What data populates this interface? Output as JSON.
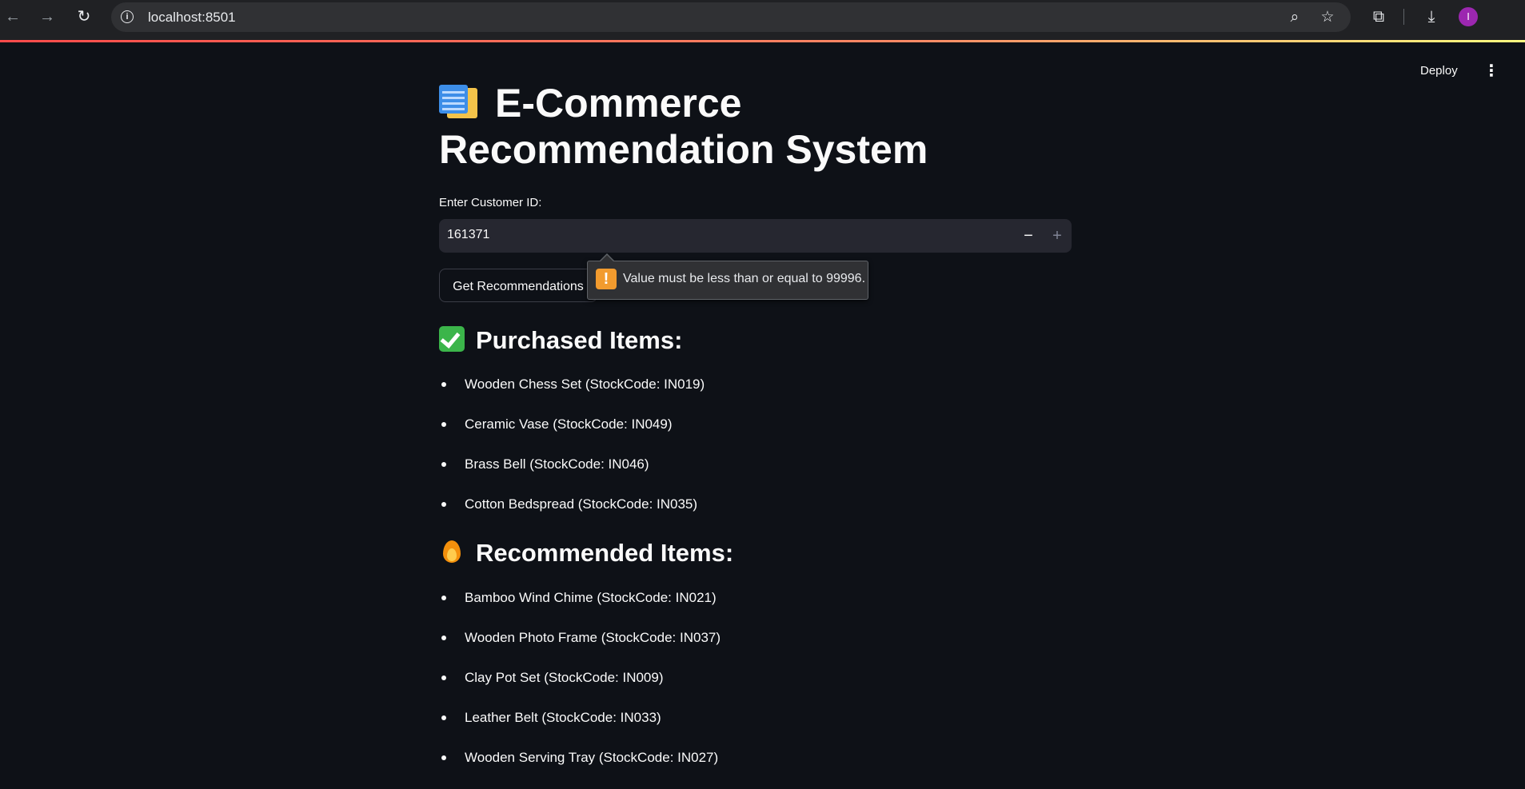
{
  "browser": {
    "url": "localhost:8501",
    "avatar_letter": "I"
  },
  "app_header": {
    "deploy_label": "Deploy"
  },
  "page": {
    "title": "E-Commerce Recommendation System",
    "input_label": "Enter Customer ID:",
    "input_value": "161371",
    "button_label": "Get Recommendations",
    "validation_message": "Value must be less than or equal to 99996."
  },
  "purchased": {
    "heading": "Purchased Items:",
    "items": [
      "Wooden Chess Set (StockCode: IN019)",
      "Ceramic Vase (StockCode: IN049)",
      "Brass Bell (StockCode: IN046)",
      "Cotton Bedspread (StockCode: IN035)"
    ]
  },
  "recommended": {
    "heading": "Recommended Items:",
    "items": [
      "Bamboo Wind Chime (StockCode: IN021)",
      "Wooden Photo Frame (StockCode: IN037)",
      "Clay Pot Set (StockCode: IN009)",
      "Leather Belt (StockCode: IN033)",
      "Wooden Serving Tray (StockCode: IN027)"
    ]
  },
  "icons": {
    "title": "calendar-memo-icon",
    "purchased": "check-mark-icon",
    "recommended": "fire-icon",
    "warning": "warning-icon"
  },
  "colors": {
    "background": "#0e1117",
    "input_bg": "#262730",
    "accent": "#ff4b4b",
    "warning": "#f29b2e",
    "check": "#3bb54a"
  }
}
